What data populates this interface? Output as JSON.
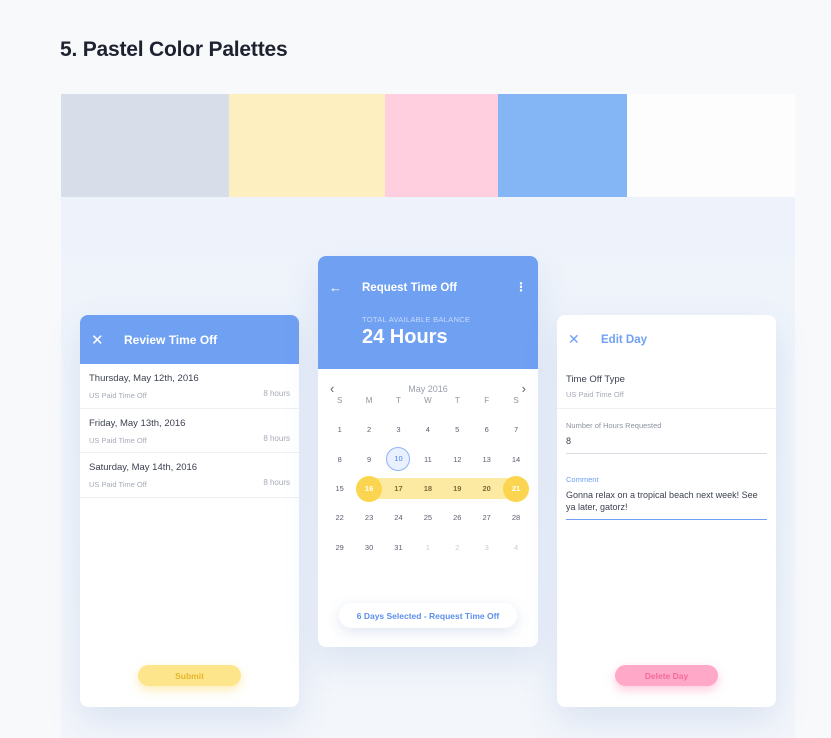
{
  "page": {
    "title": "5. Pastel Color Palettes"
  },
  "palette": [
    {
      "color": "#d7dde9"
    },
    {
      "color": "#fdefc0"
    },
    {
      "color": "#ffcedf"
    },
    {
      "color": "#84b5f4"
    },
    {
      "color": "#fdfdfe"
    }
  ],
  "review_card": {
    "title": "Review Time Off",
    "days": [
      {
        "date": "Thursday, May 12th, 2016",
        "type": "US Paid Time Off",
        "hours": "8 hours"
      },
      {
        "date": "Friday, May 13th, 2016",
        "type": "US Paid Time Off",
        "hours": "8 hours"
      },
      {
        "date": "Saturday, May 14th, 2016",
        "type": "US Paid Time Off",
        "hours": "8 hours"
      }
    ],
    "submit_label": "Submit"
  },
  "request_card": {
    "title": "Request Time Off",
    "balance_label": "TOTAL AVAILABLE BALANCE",
    "balance_value": "24 Hours",
    "month_label": "May 2016",
    "weekdays": [
      "S",
      "M",
      "T",
      "W",
      "T",
      "F",
      "S"
    ],
    "weeks": [
      [
        "1",
        "2",
        "3",
        "4",
        "5",
        "6",
        "7"
      ],
      [
        "8",
        "9",
        "10",
        "11",
        "12",
        "13",
        "14"
      ],
      [
        "15",
        "16",
        "17",
        "18",
        "19",
        "20",
        "21"
      ],
      [
        "22",
        "23",
        "24",
        "25",
        "26",
        "27",
        "28"
      ],
      [
        "29",
        "30",
        "31",
        "1",
        "2",
        "3",
        "4"
      ]
    ],
    "today": "10",
    "selected_range": [
      "16",
      "21"
    ],
    "cta_label": "6 Days Selected - Request Time Off"
  },
  "edit_card": {
    "title": "Edit Day",
    "type_label": "Time Off Type",
    "type_value": "US Paid Time Off",
    "hours_label": "Number of Hours Requested",
    "hours_value": "8",
    "comment_label": "Comment",
    "comment_value": "Gonna relax on a tropical beach next week! See ya later, gatorz!",
    "delete_label": "Delete Day"
  },
  "colors": {
    "accent_blue": "#6fa0f2",
    "accent_yellow": "#fbd54f",
    "accent_pink": "#ffa8c8"
  }
}
